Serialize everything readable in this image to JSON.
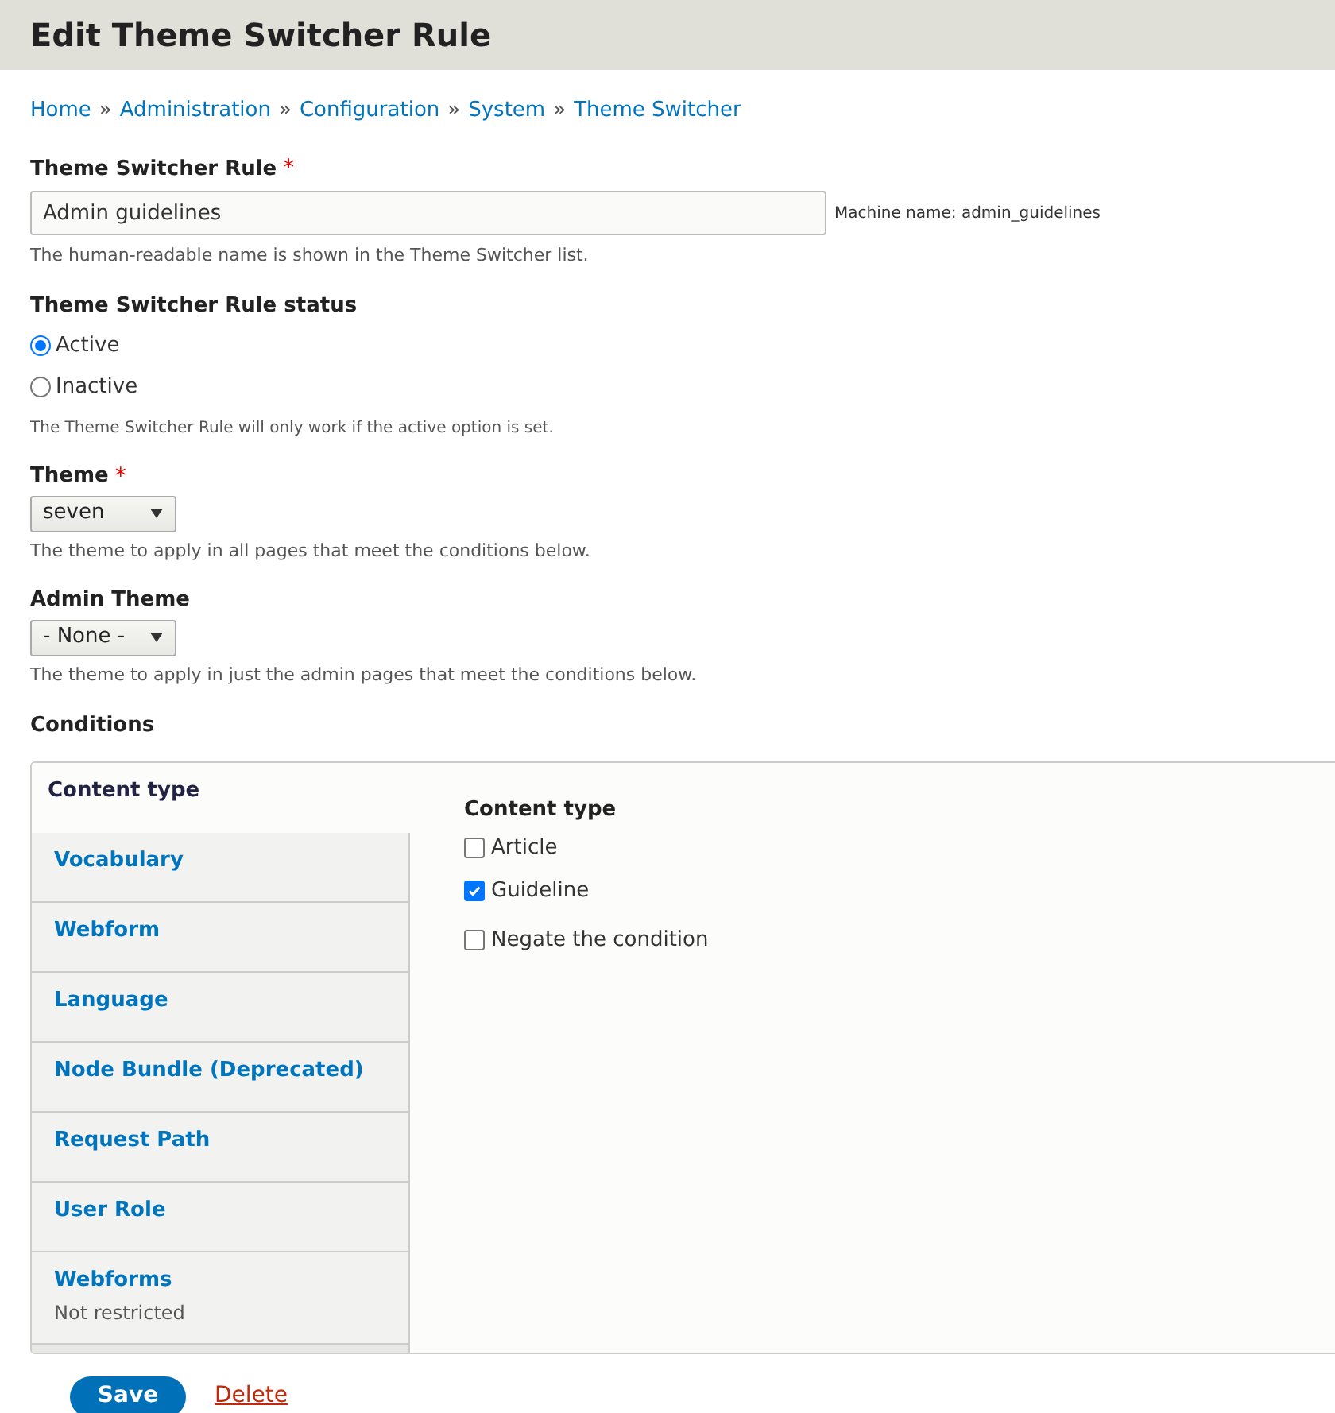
{
  "page_title": "Edit Theme Switcher Rule",
  "breadcrumb": [
    "Home",
    "Administration",
    "Configuration",
    "System",
    "Theme Switcher"
  ],
  "breadcrumb_separator": "»",
  "name_field": {
    "label": "Theme Switcher Rule",
    "required_mark": "*",
    "value": "Admin guidelines",
    "machine_name": "Machine name: admin_guidelines",
    "description": "The human-readable name is shown in the Theme Switcher list."
  },
  "status": {
    "label": "Theme Switcher Rule status",
    "options": [
      {
        "label": "Active",
        "selected": true
      },
      {
        "label": "Inactive",
        "selected": false
      }
    ],
    "description": "The Theme Switcher Rule will only work if the active option is set."
  },
  "selects": [
    {
      "label": "Theme",
      "required_mark": "*",
      "value": "seven",
      "description": "The theme to apply in all pages that meet the conditions below."
    },
    {
      "label": "Admin Theme",
      "value": "- None -",
      "description": "The theme to apply in just the admin pages that meet the conditions below."
    }
  ],
  "conditions": {
    "label": "Conditions",
    "tabs": [
      {
        "label": "Content type",
        "selected": true
      },
      {
        "label": "Vocabulary",
        "selected": false
      },
      {
        "label": "Webform",
        "selected": false
      },
      {
        "label": "Language",
        "selected": false
      },
      {
        "label": "Node Bundle (Deprecated)",
        "selected": false
      },
      {
        "label": "Request Path",
        "selected": false
      },
      {
        "label": "User Role",
        "selected": false
      },
      {
        "label": "Webforms",
        "summary": "Not restricted",
        "selected": false
      }
    ],
    "panel": {
      "title": "Content type",
      "checkboxes": [
        {
          "label": "Article",
          "checked": false
        },
        {
          "label": "Guideline",
          "checked": true
        }
      ],
      "negate": {
        "label": "Negate the condition",
        "checked": false
      }
    }
  },
  "actions": {
    "save": "Save",
    "delete": "Delete"
  }
}
